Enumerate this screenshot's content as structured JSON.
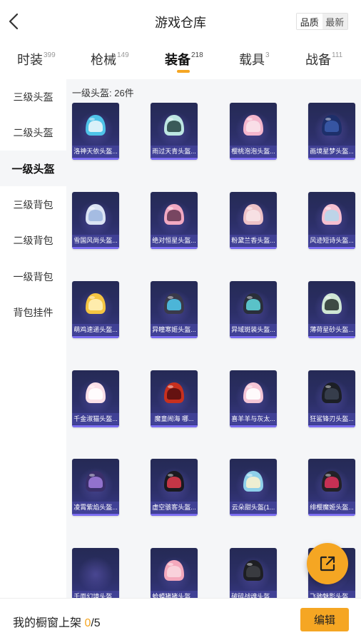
{
  "header": {
    "title": "游戏仓库",
    "sort_options": [
      "品质",
      "最新"
    ]
  },
  "tabs": [
    {
      "label": "时装",
      "count": "399"
    },
    {
      "label": "枪械",
      "count": "149"
    },
    {
      "label": "装备",
      "count": "218",
      "active": true
    },
    {
      "label": "载具",
      "count": "3"
    },
    {
      "label": "战备",
      "count": "111"
    }
  ],
  "sidebar": {
    "items": [
      "三级头盔",
      "二级头盔",
      "一级头盔",
      "三级背包",
      "二级背包",
      "一级背包",
      "背包挂件"
    ],
    "active": "一级头盔"
  },
  "content": {
    "count_label": "一级头盔: 26件",
    "items": [
      {
        "name": "洛神天依头盔...",
        "color": "#4fc3e8",
        "visor": "#e9f6fb"
      },
      {
        "name": "雨过天青头盔...",
        "color": "#bde6e2",
        "visor": "#2b4a4a"
      },
      {
        "name": "樱桃泡泡头盔...",
        "color": "#f4b6cc",
        "visor": "#f9e2ea"
      },
      {
        "name": "画境星梦头盔...",
        "color": "#1d2f6a",
        "visor": "#3a5aa8"
      },
      {
        "name": "雪国风尚头盔...",
        "color": "#dbe4f4",
        "visor": "#9fb7e0"
      },
      {
        "name": "绝对恒星头盔...",
        "color": "#f2a9c2",
        "visor": "#6a3b56"
      },
      {
        "name": "粉黛兰香头盔...",
        "color": "#eec2c7",
        "visor": "#f7e3e6"
      },
      {
        "name": "风迹短诗头盔...",
        "color": "#f6c0d0",
        "visor": "#b7d6ea"
      },
      {
        "name": "萌鸡速递头盔...",
        "color": "#f5c542",
        "visor": "#fff0b8"
      },
      {
        "name": "异瞳寒姬头盔...",
        "color": "#3a3a4a",
        "visor": "#4fc3e8"
      },
      {
        "name": "异域斑装头盔...",
        "color": "#2a2f3a",
        "visor": "#5fd3d8"
      },
      {
        "name": "薄荷星砂头盔...",
        "color": "#cfe6d4",
        "visor": "#2e3a34"
      },
      {
        "name": "千金淑猫头盔...",
        "color": "#fbe0e8",
        "visor": "#ffffff"
      },
      {
        "name": "魔童闹海 哪...",
        "color": "#c8301e",
        "visor": "#5a1010"
      },
      {
        "name": "喜羊羊与灰太...",
        "color": "#f5c6d6",
        "visor": "#ffffff"
      },
      {
        "name": "狂鲨锋刃头盔...",
        "color": "#1c1f26",
        "visor": "#3a4050"
      },
      {
        "name": "凌霄紫焰头盔...",
        "color": "#3a2f6a",
        "visor": "#9c7ad8"
      },
      {
        "name": "虚空骇客头盔...",
        "color": "#1a1a1f",
        "visor": "#d63a4a"
      },
      {
        "name": "云朵甜头盔(1...",
        "color": "#8fd0ea",
        "visor": "#f8f1cf"
      },
      {
        "name": "绯樱魔姬头盔...",
        "color": "#232126",
        "visor": "#d8325a"
      },
      {
        "name": "千面幻境头盔...",
        "color": "",
        "visor": ""
      },
      {
        "name": "蛤蟆猪猪头盔...",
        "color": "#f4a8bc",
        "visor": "#f9d5de"
      },
      {
        "name": "破碎战魂头盔...",
        "color": "#1e1f23",
        "visor": "#3c3e44"
      },
      {
        "name": "飞驰魅影头盔...",
        "color": "#f0f0f4",
        "visor": "#1a1a1f"
      }
    ]
  },
  "footer": {
    "shelf_label": "我的橱窗上架 ",
    "shelf_current": "0",
    "shelf_total": "/5",
    "edit_label": "编辑"
  }
}
